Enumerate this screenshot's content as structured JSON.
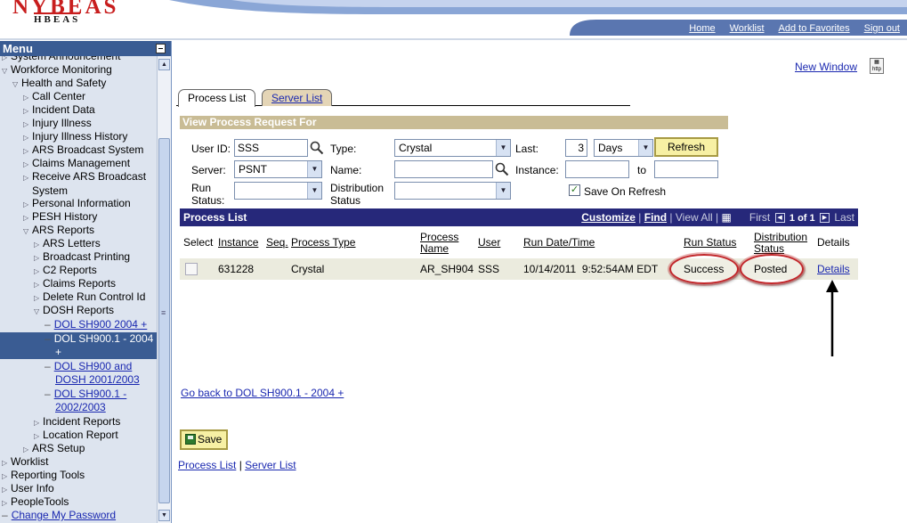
{
  "header": {
    "logo_line1": "NYBEAS",
    "logo_line2": "HBEAS",
    "nav": [
      "Home",
      "Worklist",
      "Add to Favorites",
      "Sign out"
    ]
  },
  "menu": {
    "title": "Menu",
    "items": [
      {
        "label": "System Announcement",
        "depth": 0,
        "icon": "triangle-right-icon"
      },
      {
        "label": "Workforce Monitoring",
        "depth": 0,
        "icon": "triangle-down-icon"
      },
      {
        "label": "Health and Safety",
        "depth": 1,
        "icon": "triangle-down-icon"
      },
      {
        "label": "Call Center",
        "depth": 2,
        "icon": "triangle-right-icon"
      },
      {
        "label": "Incident Data",
        "depth": 2,
        "icon": "triangle-right-icon"
      },
      {
        "label": "Injury Illness",
        "depth": 2,
        "icon": "triangle-right-icon"
      },
      {
        "label": "Injury Illness History",
        "depth": 2,
        "icon": "triangle-right-icon"
      },
      {
        "label": "ARS Broadcast System",
        "depth": 2,
        "icon": "triangle-right-icon"
      },
      {
        "label": "Claims Management",
        "depth": 2,
        "icon": "triangle-right-icon"
      },
      {
        "label": "Receive ARS Broadcast",
        "label2": "System",
        "depth": 2,
        "icon": "triangle-right-icon"
      },
      {
        "label": "Personal Information",
        "depth": 2,
        "icon": "triangle-right-icon"
      },
      {
        "label": "PESH History",
        "depth": 2,
        "icon": "triangle-right-icon"
      },
      {
        "label": "ARS Reports",
        "depth": 2,
        "icon": "triangle-down-icon"
      },
      {
        "label": "ARS Letters",
        "depth": 3,
        "icon": "triangle-right-icon"
      },
      {
        "label": "Broadcast Printing",
        "depth": 3,
        "icon": "triangle-right-icon"
      },
      {
        "label": "C2 Reports",
        "depth": 3,
        "icon": "triangle-right-icon"
      },
      {
        "label": "Claims Reports",
        "depth": 3,
        "icon": "triangle-right-icon"
      },
      {
        "label": "Delete Run Control Id",
        "depth": 3,
        "icon": "triangle-right-icon"
      },
      {
        "label": "DOSH Reports",
        "depth": 3,
        "icon": "triangle-down-icon"
      },
      {
        "label": "DOL SH900 2004 +",
        "depth": 4,
        "icon": "dash-icon"
      },
      {
        "label": "DOL SH900.1 - 2004",
        "label2": "+",
        "depth": 4,
        "icon": "dash-icon",
        "selected": true
      },
      {
        "label": "DOL SH900 and",
        "label2": "DOSH 2001/2003",
        "depth": 4,
        "icon": "dash-icon"
      },
      {
        "label": "DOL SH900.1 -",
        "label2": "2002/2003",
        "depth": 4,
        "icon": "dash-icon"
      },
      {
        "label": "Incident Reports",
        "depth": 3,
        "icon": "triangle-right-icon"
      },
      {
        "label": "Location Report",
        "depth": 3,
        "icon": "triangle-right-icon"
      },
      {
        "label": "ARS Setup",
        "depth": 2,
        "icon": "triangle-right-icon"
      },
      {
        "label": "Worklist",
        "depth": 0,
        "icon": "triangle-right-icon"
      },
      {
        "label": "Reporting Tools",
        "depth": 0,
        "icon": "triangle-right-icon"
      },
      {
        "label": "User Info",
        "depth": 0,
        "icon": "triangle-right-icon"
      },
      {
        "label": "PeopleTools",
        "depth": 0,
        "icon": "triangle-right-icon"
      },
      {
        "label": "Change My Password",
        "depth": 0,
        "icon": "dash-icon",
        "link": true
      }
    ]
  },
  "new_window": "New Window",
  "tabs": {
    "process_list": "Process List",
    "server_list": "Server List"
  },
  "request": {
    "section_title": "View Process Request For",
    "user_id_label": "User ID:",
    "user_id_value": "SSS",
    "type_label": "Type:",
    "type_value": "Crystal",
    "last_label": "Last:",
    "last_value": "3",
    "last_unit": "Days",
    "refresh": "Refresh",
    "server_label": "Server:",
    "server_value": "PSNT",
    "name_label": "Name:",
    "name_value": "",
    "instance_label": "Instance:",
    "instance_from": "",
    "to_label": "to",
    "instance_to": "",
    "run_status_label1": "Run",
    "run_status_label2": "Status:",
    "run_status_value": "",
    "dist_status_label1": "Distribution",
    "dist_status_label2": "Status",
    "dist_status_value": "",
    "save_on_refresh": "Save On Refresh",
    "save_on_refresh_checked": true
  },
  "grid": {
    "title": "Process List",
    "customize": "Customize",
    "find": "Find",
    "view_all": "View All",
    "first": "First",
    "range": "1 of 1",
    "last": "Last",
    "columns": {
      "select": "Select",
      "instance": "Instance",
      "seq": "Seq.",
      "process_type": "Process Type",
      "process_name1": "Process",
      "process_name2": "Name",
      "user": "User",
      "run_datetime": "Run Date/Time",
      "run_status": "Run Status",
      "dist_status1": "Distribution",
      "dist_status2": "Status",
      "details": "Details"
    },
    "rows": [
      {
        "instance": "631228",
        "seq": "",
        "process_type": "Crystal",
        "process_name": "AR_SH904",
        "user": "SSS",
        "run_datetime": "10/14/2011  9:52:54AM EDT",
        "run_status": "Success",
        "dist_status": "Posted",
        "details": "Details"
      }
    ]
  },
  "go_back": "Go back to DOL SH900.1 - 2004 +",
  "save": "Save",
  "footer": {
    "process_list": "Process List",
    "sep": "|",
    "server_list": "Server List"
  },
  "colors": {
    "menu_header": "#3a5c93",
    "grid_header": "#26287a",
    "section_bar": "#c9bc95",
    "highlight_oval": "#c2272b"
  }
}
